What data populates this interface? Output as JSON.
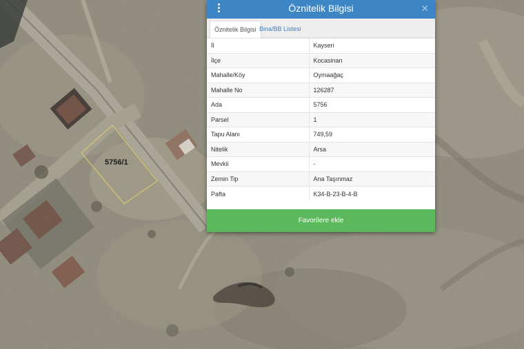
{
  "map": {
    "parcel_label": "5756/1"
  },
  "panel": {
    "title": "Öznitelik Bilgisi",
    "menu_icon": "vertical-dots-icon",
    "close_icon": "close-icon",
    "close_glyph": "✕",
    "tabs": [
      {
        "label": "Öznitelik Bilgisi",
        "active": true
      },
      {
        "label": "Bina/BB Listesi",
        "active": false
      }
    ],
    "rows": [
      {
        "key": "İl",
        "value": "Kayseri"
      },
      {
        "key": "İlçe",
        "value": "Kocasinan"
      },
      {
        "key": "Mahalle/Köy",
        "value": "Oymaağaç"
      },
      {
        "key": "Mahalle No",
        "value": "126287"
      },
      {
        "key": "Ada",
        "value": "5756"
      },
      {
        "key": "Parsel",
        "value": "1"
      },
      {
        "key": "Tapu Alanı",
        "value": "749,59"
      },
      {
        "key": "Nitelik",
        "value": "Arsa"
      },
      {
        "key": "Mevkii",
        "value": "-"
      },
      {
        "key": "Zemin Tip",
        "value": "Ana Taşınmaz"
      },
      {
        "key": "Pafta",
        "value": "K34-B-23-B-4-B"
      }
    ],
    "favorite_button": "Favorilere ekle",
    "colors": {
      "header": "#3d86c6",
      "button": "#5cb85c",
      "tab_link": "#3d7fc4",
      "parcel_outline": "#d8c56a"
    }
  }
}
